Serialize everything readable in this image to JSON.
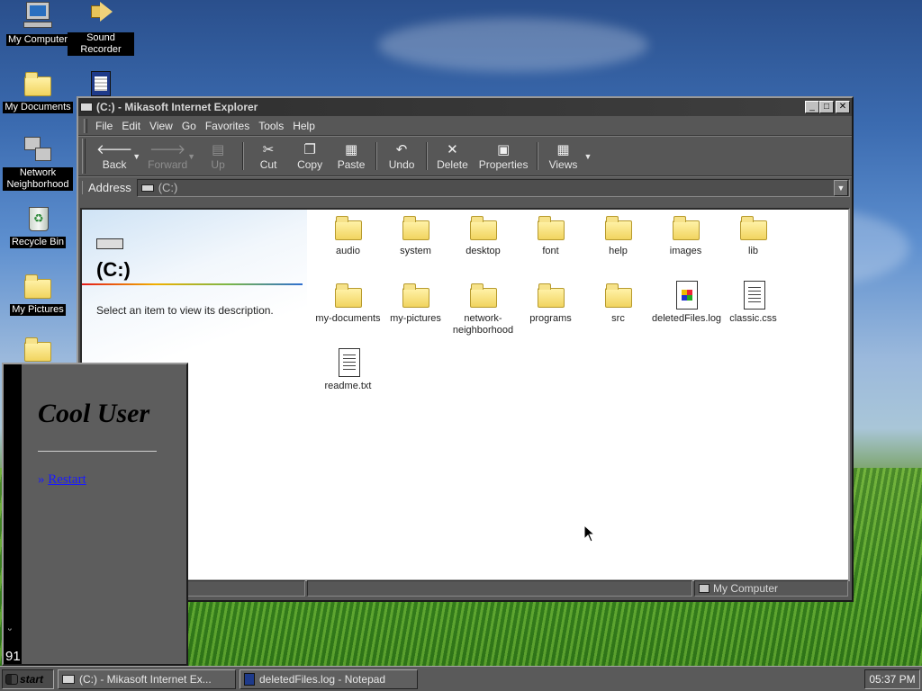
{
  "desktop": {
    "icons": [
      {
        "label": "My Computer",
        "icon": "computer-icon"
      },
      {
        "label": "Sound Recorder",
        "icon": "speaker-icon"
      },
      {
        "label": "My Documents",
        "icon": "folder-icon"
      },
      {
        "label": "Network Neighborhood",
        "icon": "network-icon"
      },
      {
        "label": "Recycle Bin",
        "icon": "recycle-bin-icon"
      },
      {
        "label": "My Pictures",
        "icon": "folder-icon"
      }
    ]
  },
  "window": {
    "title": "(C:) - Mikasoft Internet Explorer",
    "menu": [
      "File",
      "Edit",
      "View",
      "Go",
      "Favorites",
      "Tools",
      "Help"
    ],
    "toolbar": {
      "back": "Back",
      "forward": "Forward",
      "up": "Up",
      "cut": "Cut",
      "copy": "Copy",
      "paste": "Paste",
      "undo": "Undo",
      "delete": "Delete",
      "properties": "Properties",
      "views": "Views"
    },
    "address": {
      "label": "Address",
      "value": "(C:)"
    },
    "sidebar": {
      "title": "(C:)",
      "description": "Select an item to view its description."
    },
    "files": [
      {
        "name": "audio",
        "type": "folder"
      },
      {
        "name": "system",
        "type": "folder"
      },
      {
        "name": "desktop",
        "type": "folder"
      },
      {
        "name": "font",
        "type": "folder"
      },
      {
        "name": "help",
        "type": "folder"
      },
      {
        "name": "images",
        "type": "folder"
      },
      {
        "name": "lib",
        "type": "folder"
      },
      {
        "name": "my-documents",
        "type": "folder"
      },
      {
        "name": "my-pictures",
        "type": "folder"
      },
      {
        "name": "network-neighborhood",
        "type": "folder"
      },
      {
        "name": "programs",
        "type": "folder"
      },
      {
        "name": "src",
        "type": "folder"
      },
      {
        "name": "deletedFiles.log",
        "type": "log"
      },
      {
        "name": "classic.css",
        "type": "document"
      },
      {
        "name": "readme.txt",
        "type": "document"
      }
    ],
    "status": {
      "location": "My Computer"
    }
  },
  "start_menu": {
    "user": "Cool User",
    "restart_prefix": "»",
    "restart": "Restart",
    "banner_number": "91",
    "banner_glyph": "ᵕ"
  },
  "taskbar": {
    "start": "start",
    "tasks": [
      "(C:) - Mikasoft Internet Ex...",
      "deletedFiles.log - Notepad"
    ],
    "clock": "05:37 PM"
  }
}
